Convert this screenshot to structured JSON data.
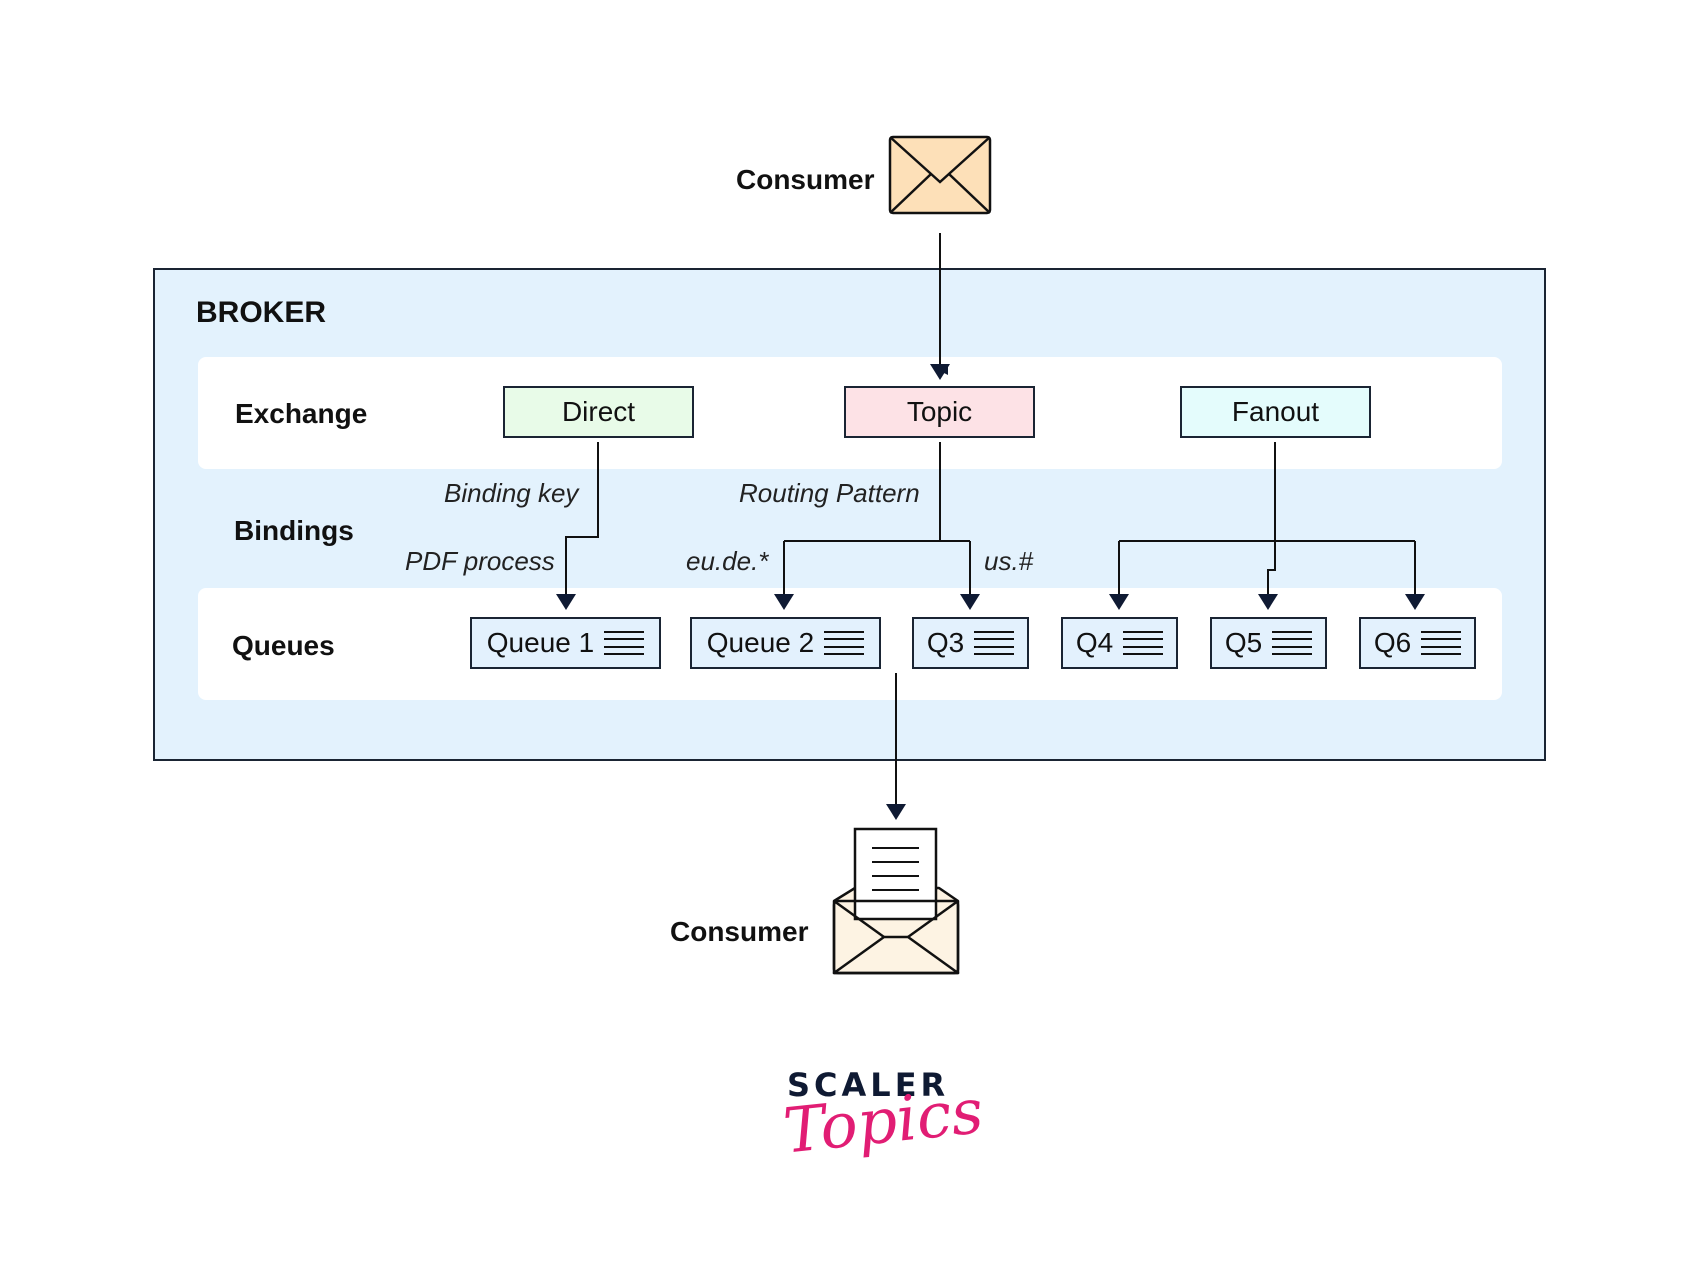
{
  "producer": {
    "label": "Consumer",
    "icon": "envelope-closed-icon",
    "color": "#fde0b8"
  },
  "broker": {
    "title": "BROKER",
    "background": "#e3f2fd"
  },
  "rows": {
    "exchange": "Exchange",
    "bindings": "Bindings",
    "queues": "Queues"
  },
  "exchanges": [
    {
      "label": "Direct",
      "color": "#e8fbe8"
    },
    {
      "label": "Topic",
      "color": "#fde2e6"
    },
    {
      "label": "Fanout",
      "color": "#e4fcfc"
    }
  ],
  "bindings": {
    "direct_header": "Binding key",
    "direct_key": "PDF process",
    "topic_header": "Routing Pattern",
    "topic_key_1": "eu.de.*",
    "topic_key_2": "us.#"
  },
  "queues": [
    {
      "label": "Queue 1"
    },
    {
      "label": "Queue 2"
    },
    {
      "label": "Q3"
    },
    {
      "label": "Q4"
    },
    {
      "label": "Q5"
    },
    {
      "label": "Q6"
    }
  ],
  "consumer": {
    "label": "Consumer",
    "icon": "envelope-open-letter-icon",
    "color": "#fdf3e3"
  },
  "logo": {
    "line1": "SCALER",
    "line2": "Topics",
    "accent": "#e11d74",
    "dark": "#0f1a33"
  }
}
